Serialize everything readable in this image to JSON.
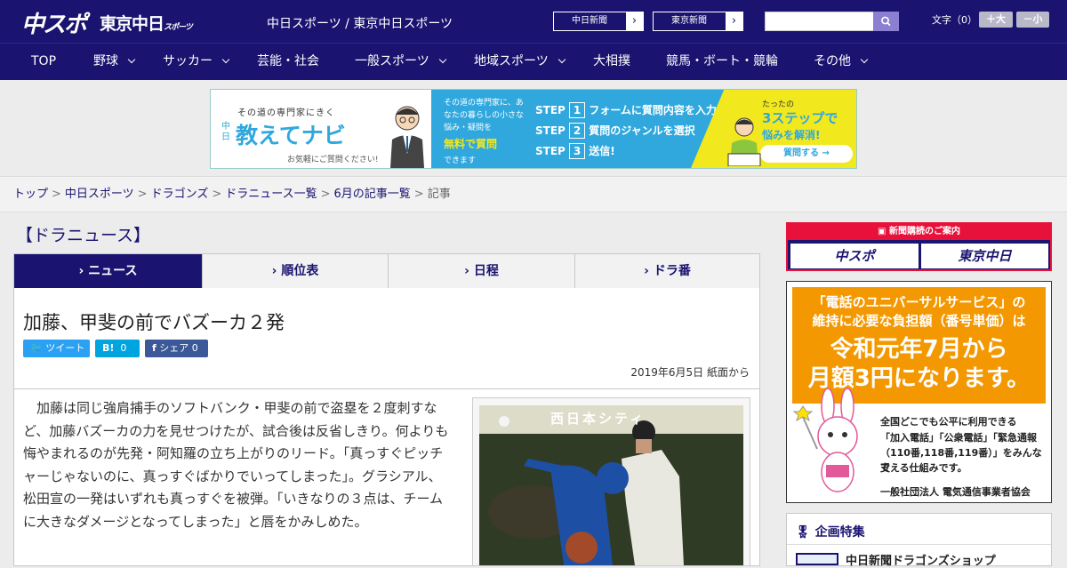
{
  "header": {
    "logo_chuspo": "中スポ",
    "logo_tokyo": "東京中日",
    "logo_tokyo_sub": "スポーツ",
    "site_title": "中日スポーツ / 東京中日スポーツ",
    "paper_links": [
      "中日新聞",
      "東京新聞"
    ],
    "search_placeholder": "",
    "font_label": "文字（0）",
    "font_bigger": "＋大",
    "font_smaller": "－小"
  },
  "nav": {
    "items": [
      {
        "label": "TOP",
        "dropdown": false
      },
      {
        "label": "野球",
        "dropdown": true
      },
      {
        "label": "サッカー",
        "dropdown": true
      },
      {
        "label": "芸能・社会",
        "dropdown": false
      },
      {
        "label": "一般スポーツ",
        "dropdown": true
      },
      {
        "label": "地域スポーツ",
        "dropdown": true
      },
      {
        "label": "大相撲",
        "dropdown": false
      },
      {
        "label": "競馬・ボート・競輪",
        "dropdown": false
      },
      {
        "label": "その他",
        "dropdown": true
      }
    ]
  },
  "banner": {
    "tagline": "その道の専門家にきく",
    "brand_small": "中日",
    "brand": "教えてナビ",
    "sub": "お気軽にご質問ください!",
    "mid_text": "その道の専門家に、あなたの暮らしの小さな悩み・疑問を",
    "free": "無料で質問",
    "dekimasu": "できます",
    "steps": [
      {
        "label": "STEP",
        "num": "1",
        "text": "フォームに質問内容を入力"
      },
      {
        "label": "STEP",
        "num": "2",
        "text": "質問のジャンルを選択"
      },
      {
        "label": "STEP",
        "num": "3",
        "text": "送信!"
      }
    ],
    "right_small": "たったの",
    "right_big": "3ステップで",
    "right_solve": "悩みを解消!",
    "right_btn": "質問する"
  },
  "breadcrumb": [
    "トップ",
    "中日スポーツ",
    "ドラゴンズ",
    "ドラニュース一覧",
    "6月の記事一覧",
    "記事"
  ],
  "section_title": "【ドラニュース】",
  "tabs": [
    "ニュース",
    "順位表",
    "日程",
    "ドラ番"
  ],
  "article": {
    "headline": "加藤、甲斐の前でバズーカ２発",
    "share": {
      "tweet": "ツイート",
      "hatena": "B!",
      "hatena_count": "0",
      "fb": "シェア",
      "fb_count": "0"
    },
    "date": "2019年6月5日 紙面から",
    "body": "加藤は同じ強肩捕手のソフトバンク・甲斐の前で盗塁を２度刺すなど、加藤バズーカの力を見せつけたが、試合後は反省しきり。何よりも悔やまれるのが先発・阿知羅の立ち上がりのリード。「真っすぐピッチャーじゃないのに、真っすぐばかりでいってしまった」。グラシアル、松田宣の一発はいずれも真っすぐを被弾。「いきなりの３点は、チームに大きなダメージとなってしまった」と唇をかみしめた。",
    "photo_sign": "西日本シティ"
  },
  "sidebar": {
    "subscribe_head": "新聞購読のご案内",
    "subscribe_btns": [
      "中スポ",
      "東京中日"
    ],
    "ad": {
      "line1": "「電話のユニバーサルサービス」の",
      "line2": "維持に必要な負担額（番号単価）は",
      "line3": "令和元年7月から",
      "line4": "月額3円になります。",
      "small1": "全国どこでも公平に利用できる",
      "small2": "「加入電話」「公衆電話」「緊急通報",
      "small3": "（110番,118番,119番）」をみんなで",
      "small4": "支える仕組みです。",
      "org": "一般社団法人 電気通信事業者協会"
    },
    "feature_title": "企画特集",
    "feature_item": "中日新聞ドラゴンズショップ"
  }
}
